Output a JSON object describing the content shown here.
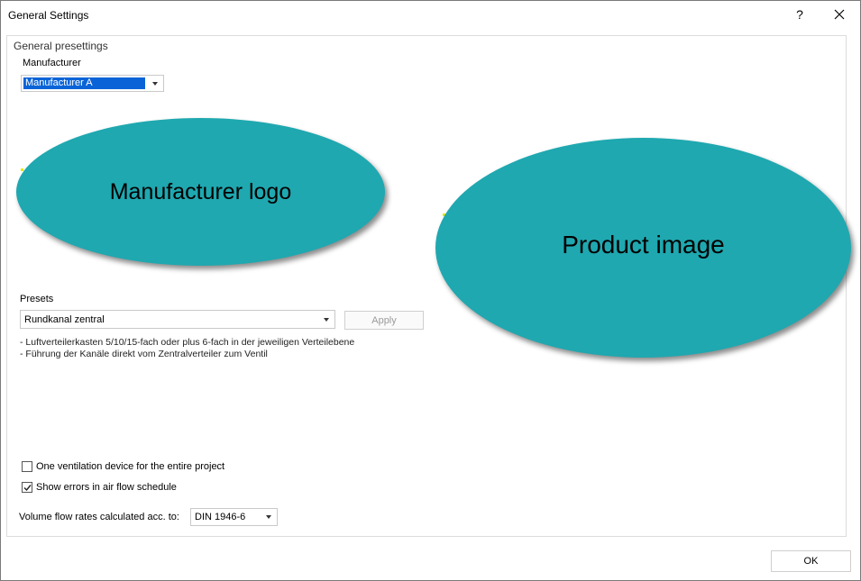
{
  "window": {
    "title": "General Settings",
    "help_label": "?"
  },
  "group": {
    "title": "General presettings"
  },
  "manufacturer": {
    "label": "Manufacturer",
    "selected": "Manufacturer A"
  },
  "placeholders": {
    "logo": "Manufacturer logo",
    "product": "Product image",
    "color": "#1fa8b0"
  },
  "presets": {
    "label": "Presets",
    "selected": "Rundkanal zentral",
    "apply_label": "Apply",
    "description": [
      "- Luftverteilerkasten 5/10/15-fach oder plus 6-fach in der jeweiligen Verteilebene",
      "- Führung der Kanäle direkt vom Zentralverteiler zum Ventil"
    ]
  },
  "options": {
    "one_device_label": "One ventilation device for the entire project",
    "one_device_checked": false,
    "show_errors_label": "Show errors in air flow schedule",
    "show_errors_checked": true
  },
  "volume_flow": {
    "label": "Volume flow rates calculated acc. to:",
    "selected": "DIN 1946-6"
  },
  "footer": {
    "ok_label": "OK"
  }
}
